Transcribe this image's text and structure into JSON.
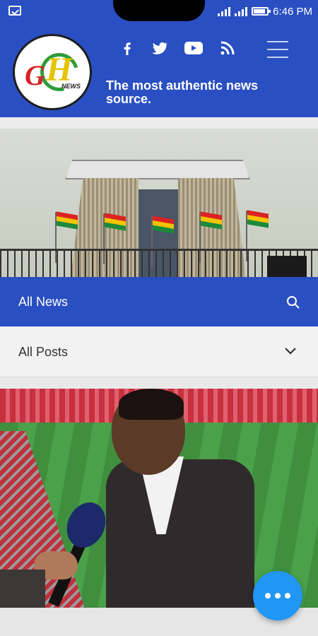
{
  "status_bar": {
    "time": "6:46 PM"
  },
  "header": {
    "logo_text": "GH",
    "logo_subtext": "NEWS",
    "tagline": "The most authentic news source.",
    "social_icons": [
      "facebook-icon",
      "twitter-icon",
      "youtube-icon",
      "rss-icon"
    ],
    "menu_icon": "hamburger-menu-icon"
  },
  "category_bar": {
    "label": "All News",
    "icon": "search-icon"
  },
  "filter": {
    "selected": "All Posts",
    "icon": "chevron-down-icon"
  },
  "fab": {
    "icon": "more-dots-icon"
  },
  "colors": {
    "brand_blue": "#2a4fc2",
    "fab_blue": "#2196f3",
    "text_dark": "#333333"
  }
}
